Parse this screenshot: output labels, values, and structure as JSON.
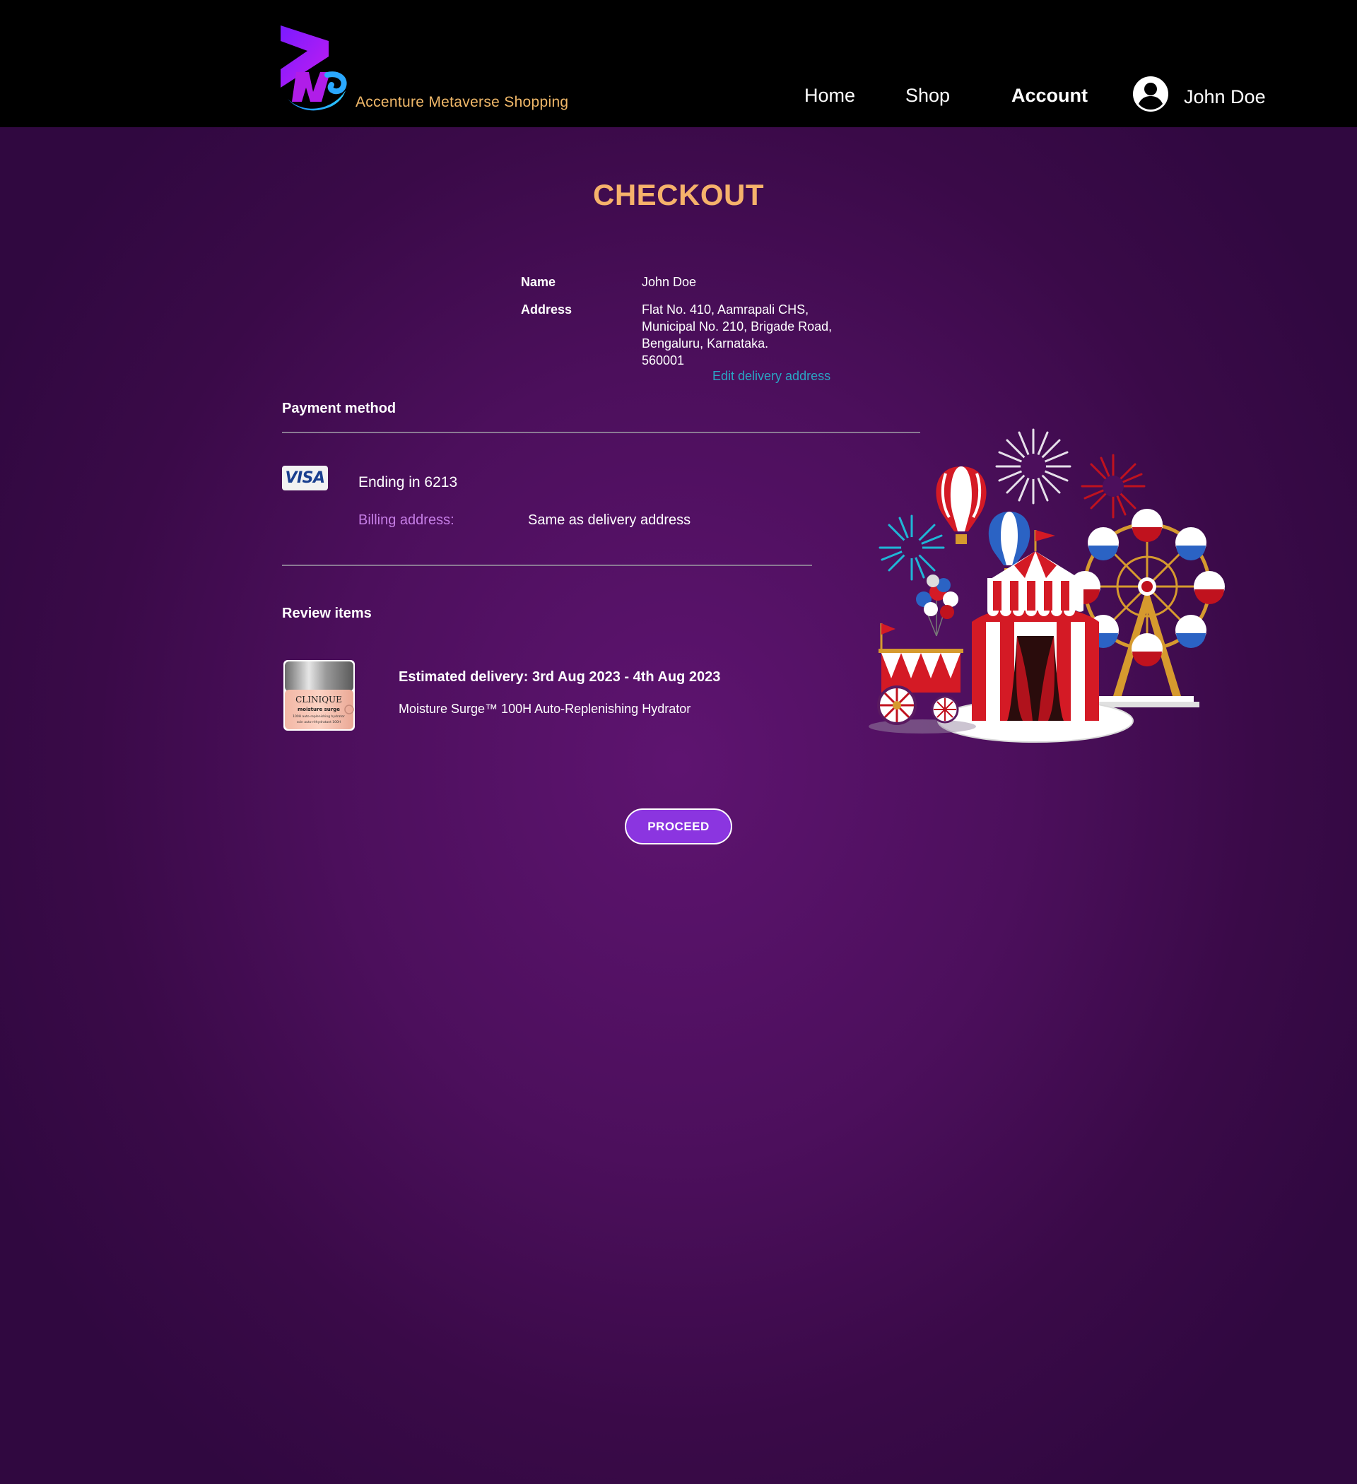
{
  "header": {
    "brand_name": "Accenture Metaverse Shopping",
    "logo_icon": "ams-logo-icon",
    "nav": {
      "home": "Home",
      "shop": "Shop",
      "account": "Account"
    },
    "user": {
      "icon": "user-avatar-icon",
      "name": "John Doe"
    }
  },
  "main": {
    "title": "CHECKOUT",
    "shipping": {
      "name_label": "Name",
      "name_value": "John Doe",
      "address_label": "Address",
      "address_lines": [
        "Flat No. 410, Aamrapali CHS,",
        "Municipal No. 210, Brigade Road,",
        "Bengaluru, Karnataka.",
        "560001"
      ],
      "edit_link": "Edit delivery address"
    },
    "payment": {
      "title": "Payment method",
      "card_brand": "VISA",
      "card_ending": "Ending in 6213",
      "billing_label": "Billing address:",
      "billing_value": "Same as delivery address"
    },
    "review": {
      "title": "Review items",
      "delivery": "Estimated delivery: 3rd Aug 2023 - 4th Aug 2023",
      "product_name": "Moisture Surge™ 100H Auto-Replenishing Hydrator",
      "product_image": {
        "brand": "CLINIQUE",
        "line": "moisture surge",
        "fine_print_1": "100H auto-replenishing hydrator",
        "fine_print_2": "soin auto-réhydratant 100H"
      }
    },
    "proceed_label": "PROCEED"
  },
  "colors": {
    "header_bg": "#000000",
    "page_bg": "#4c0f5c",
    "title": "#f6b26b",
    "brand": "#f0b869",
    "link": "#2aa6c4",
    "billing_label": "#c67ee6",
    "button": "#8b35e0"
  }
}
